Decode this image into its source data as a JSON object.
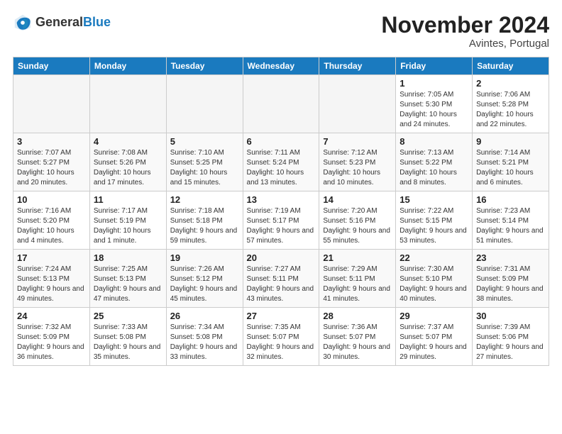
{
  "header": {
    "logo_general": "General",
    "logo_blue": "Blue",
    "month_title": "November 2024",
    "location": "Avintes, Portugal"
  },
  "weekdays": [
    "Sunday",
    "Monday",
    "Tuesday",
    "Wednesday",
    "Thursday",
    "Friday",
    "Saturday"
  ],
  "weeks": [
    [
      {
        "day": "",
        "info": ""
      },
      {
        "day": "",
        "info": ""
      },
      {
        "day": "",
        "info": ""
      },
      {
        "day": "",
        "info": ""
      },
      {
        "day": "",
        "info": ""
      },
      {
        "day": "1",
        "info": "Sunrise: 7:05 AM\nSunset: 5:30 PM\nDaylight: 10 hours and 24 minutes."
      },
      {
        "day": "2",
        "info": "Sunrise: 7:06 AM\nSunset: 5:28 PM\nDaylight: 10 hours and 22 minutes."
      }
    ],
    [
      {
        "day": "3",
        "info": "Sunrise: 7:07 AM\nSunset: 5:27 PM\nDaylight: 10 hours and 20 minutes."
      },
      {
        "day": "4",
        "info": "Sunrise: 7:08 AM\nSunset: 5:26 PM\nDaylight: 10 hours and 17 minutes."
      },
      {
        "day": "5",
        "info": "Sunrise: 7:10 AM\nSunset: 5:25 PM\nDaylight: 10 hours and 15 minutes."
      },
      {
        "day": "6",
        "info": "Sunrise: 7:11 AM\nSunset: 5:24 PM\nDaylight: 10 hours and 13 minutes."
      },
      {
        "day": "7",
        "info": "Sunrise: 7:12 AM\nSunset: 5:23 PM\nDaylight: 10 hours and 10 minutes."
      },
      {
        "day": "8",
        "info": "Sunrise: 7:13 AM\nSunset: 5:22 PM\nDaylight: 10 hours and 8 minutes."
      },
      {
        "day": "9",
        "info": "Sunrise: 7:14 AM\nSunset: 5:21 PM\nDaylight: 10 hours and 6 minutes."
      }
    ],
    [
      {
        "day": "10",
        "info": "Sunrise: 7:16 AM\nSunset: 5:20 PM\nDaylight: 10 hours and 4 minutes."
      },
      {
        "day": "11",
        "info": "Sunrise: 7:17 AM\nSunset: 5:19 PM\nDaylight: 10 hours and 1 minute."
      },
      {
        "day": "12",
        "info": "Sunrise: 7:18 AM\nSunset: 5:18 PM\nDaylight: 9 hours and 59 minutes."
      },
      {
        "day": "13",
        "info": "Sunrise: 7:19 AM\nSunset: 5:17 PM\nDaylight: 9 hours and 57 minutes."
      },
      {
        "day": "14",
        "info": "Sunrise: 7:20 AM\nSunset: 5:16 PM\nDaylight: 9 hours and 55 minutes."
      },
      {
        "day": "15",
        "info": "Sunrise: 7:22 AM\nSunset: 5:15 PM\nDaylight: 9 hours and 53 minutes."
      },
      {
        "day": "16",
        "info": "Sunrise: 7:23 AM\nSunset: 5:14 PM\nDaylight: 9 hours and 51 minutes."
      }
    ],
    [
      {
        "day": "17",
        "info": "Sunrise: 7:24 AM\nSunset: 5:13 PM\nDaylight: 9 hours and 49 minutes."
      },
      {
        "day": "18",
        "info": "Sunrise: 7:25 AM\nSunset: 5:13 PM\nDaylight: 9 hours and 47 minutes."
      },
      {
        "day": "19",
        "info": "Sunrise: 7:26 AM\nSunset: 5:12 PM\nDaylight: 9 hours and 45 minutes."
      },
      {
        "day": "20",
        "info": "Sunrise: 7:27 AM\nSunset: 5:11 PM\nDaylight: 9 hours and 43 minutes."
      },
      {
        "day": "21",
        "info": "Sunrise: 7:29 AM\nSunset: 5:11 PM\nDaylight: 9 hours and 41 minutes."
      },
      {
        "day": "22",
        "info": "Sunrise: 7:30 AM\nSunset: 5:10 PM\nDaylight: 9 hours and 40 minutes."
      },
      {
        "day": "23",
        "info": "Sunrise: 7:31 AM\nSunset: 5:09 PM\nDaylight: 9 hours and 38 minutes."
      }
    ],
    [
      {
        "day": "24",
        "info": "Sunrise: 7:32 AM\nSunset: 5:09 PM\nDaylight: 9 hours and 36 minutes."
      },
      {
        "day": "25",
        "info": "Sunrise: 7:33 AM\nSunset: 5:08 PM\nDaylight: 9 hours and 35 minutes."
      },
      {
        "day": "26",
        "info": "Sunrise: 7:34 AM\nSunset: 5:08 PM\nDaylight: 9 hours and 33 minutes."
      },
      {
        "day": "27",
        "info": "Sunrise: 7:35 AM\nSunset: 5:07 PM\nDaylight: 9 hours and 32 minutes."
      },
      {
        "day": "28",
        "info": "Sunrise: 7:36 AM\nSunset: 5:07 PM\nDaylight: 9 hours and 30 minutes."
      },
      {
        "day": "29",
        "info": "Sunrise: 7:37 AM\nSunset: 5:07 PM\nDaylight: 9 hours and 29 minutes."
      },
      {
        "day": "30",
        "info": "Sunrise: 7:39 AM\nSunset: 5:06 PM\nDaylight: 9 hours and 27 minutes."
      }
    ]
  ]
}
